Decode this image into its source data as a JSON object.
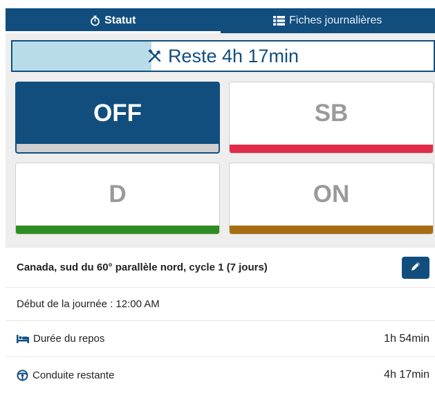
{
  "tabs": [
    {
      "label": "Statut",
      "icon": "stopwatch-icon",
      "active": true
    },
    {
      "label": "Fiches journalières",
      "icon": "list-icon",
      "active": false
    }
  ],
  "remaining": {
    "icon": "tools-icon",
    "text": "Reste 4h 17min",
    "progress_fraction": 0.33
  },
  "statuses": [
    {
      "label": "OFF",
      "color": "#cfcfcf",
      "selected": true
    },
    {
      "label": "SB",
      "color": "#e22d4a",
      "selected": false
    },
    {
      "label": "D",
      "color": "#2f8c22",
      "selected": false
    },
    {
      "label": "ON",
      "color": "#a66d12",
      "selected": false
    }
  ],
  "cycle": {
    "title": "Canada, sud du 60° parallèle nord, cycle 1 (7 jours)",
    "edit_icon": "pencil-icon"
  },
  "day_start": "Début de la journée : 12:00 AM",
  "rest": {
    "icon": "bed-icon",
    "label": "Durée du repos",
    "value": "1h 54min"
  },
  "driving": {
    "icon": "steering-wheel-icon",
    "label": "Conduite restante",
    "value": "4h 17min"
  },
  "colors": {
    "primary": "#114e7e",
    "progress_fill": "#b9dcea"
  }
}
